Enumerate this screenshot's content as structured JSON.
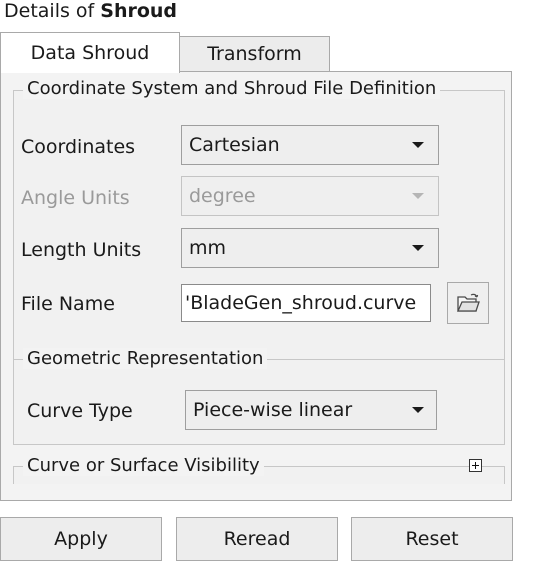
{
  "header": {
    "prefix": "Details of ",
    "object": "Shroud"
  },
  "tabs": [
    {
      "label": "Data Shroud",
      "active": true
    },
    {
      "label": "Transform",
      "active": false
    }
  ],
  "coordinate_group": {
    "title": "Coordinate System and Shroud File Definition",
    "coordinates": {
      "label": "Coordinates",
      "value": "Cartesian"
    },
    "angle_units": {
      "label": "Angle Units",
      "value": "degree",
      "disabled": true
    },
    "length_units": {
      "label": "Length Units",
      "value": "mm"
    },
    "file_name": {
      "label": "File Name",
      "value": "'BladeGen_shroud.curve"
    }
  },
  "geometric_group": {
    "title": "Geometric Representation",
    "curve_type": {
      "label": "Curve Type",
      "value": "Piece-wise linear"
    }
  },
  "visibility_group": {
    "title": "Curve or Surface Visibility",
    "collapsed": true
  },
  "buttons": {
    "apply": "Apply",
    "reread": "Reread",
    "reset": "Reset"
  },
  "icons": {
    "dropdown": "chevron-down-icon",
    "browse": "folder-open-icon",
    "expand": "plus-box-icon"
  }
}
